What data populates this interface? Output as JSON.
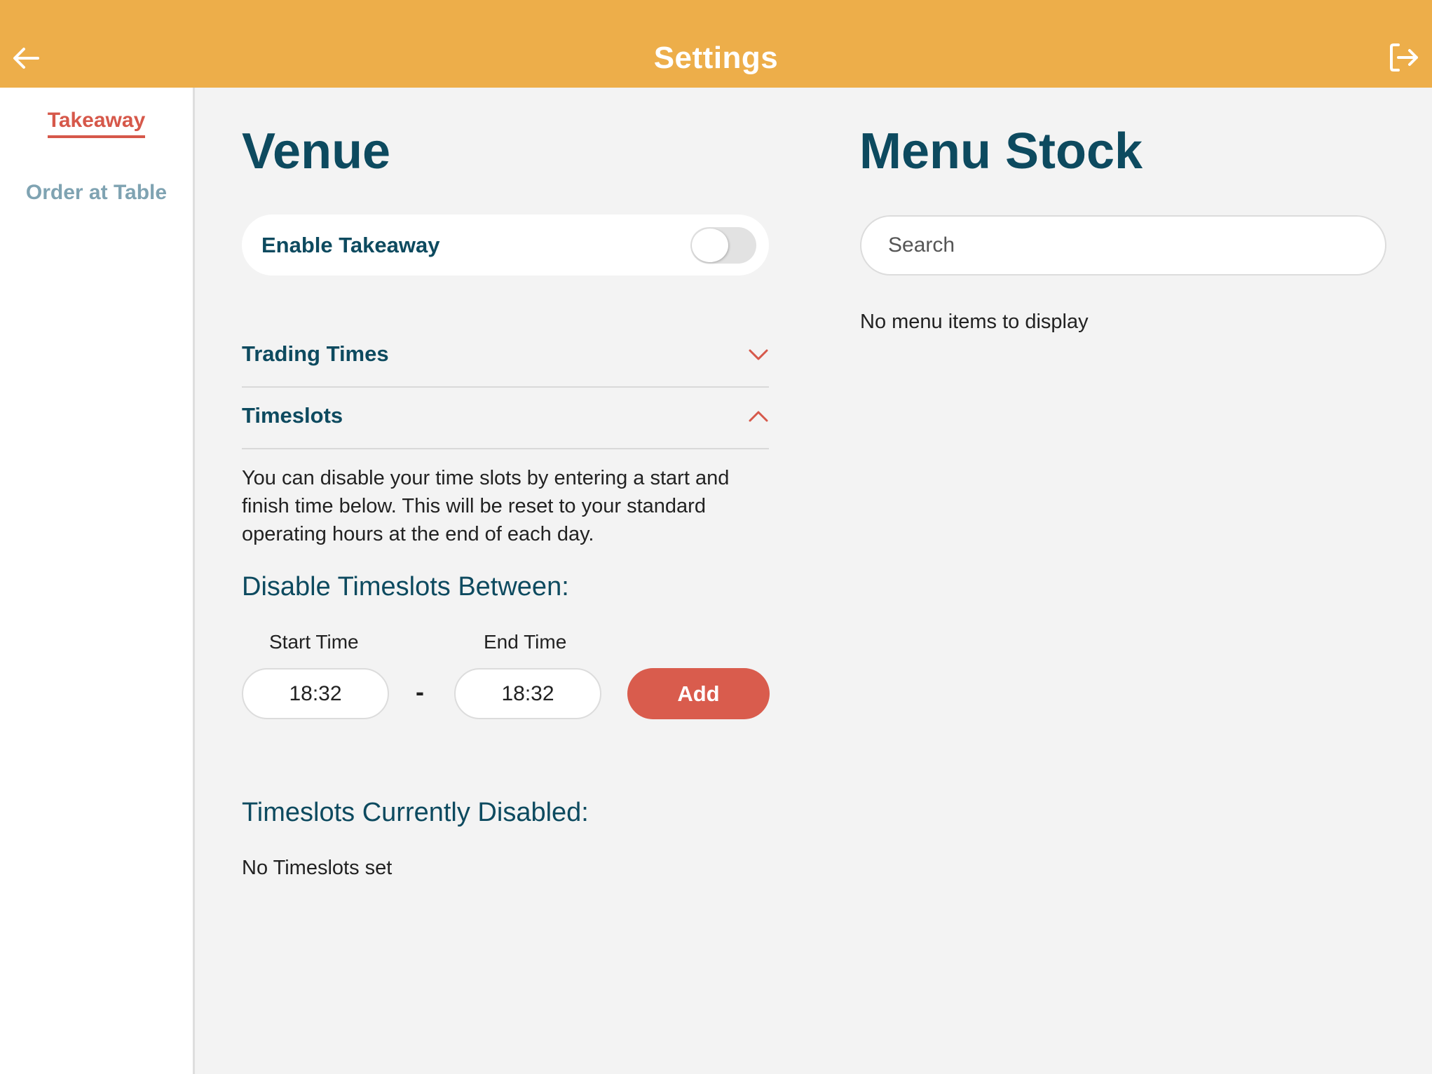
{
  "header": {
    "title": "Settings",
    "back_icon": "arrow-left-icon",
    "logout_icon": "logout-icon",
    "background_color": "#edae4a"
  },
  "sidebar": {
    "items": [
      {
        "label": "Takeaway",
        "active": true
      },
      {
        "label": "Order at Table",
        "active": false
      }
    ],
    "active_color": "#d6584a",
    "inactive_color": "#7fa3b2"
  },
  "venue": {
    "title": "Venue",
    "enable_toggle": {
      "label": "Enable Takeaway",
      "checked": false
    },
    "accordions": [
      {
        "label": "Trading Times",
        "expanded": false,
        "icon": "chevron-down-icon"
      },
      {
        "label": "Timeslots",
        "expanded": true,
        "icon": "chevron-up-icon"
      }
    ],
    "timeslots": {
      "description": "You can disable your time slots by entering a start and finish time below. This will be reset to your standard operating hours at the end of each day.",
      "disable_heading": "Disable Timeslots Between:",
      "start_label": "Start Time",
      "start_value": "18:32",
      "separator": "-",
      "end_label": "End Time",
      "end_value": "18:32",
      "add_button": "Add",
      "current_heading": "Timeslots Currently Disabled:",
      "empty_message": "No Timeslots set"
    }
  },
  "menu_stock": {
    "title": "Menu Stock",
    "search_placeholder": "Search",
    "search_value": "",
    "empty_message": "No menu items to display"
  },
  "colors": {
    "primary_text": "#0d4a5f",
    "accent": "#d95c4d",
    "header": "#edae4a",
    "background": "#f3f3f3"
  }
}
